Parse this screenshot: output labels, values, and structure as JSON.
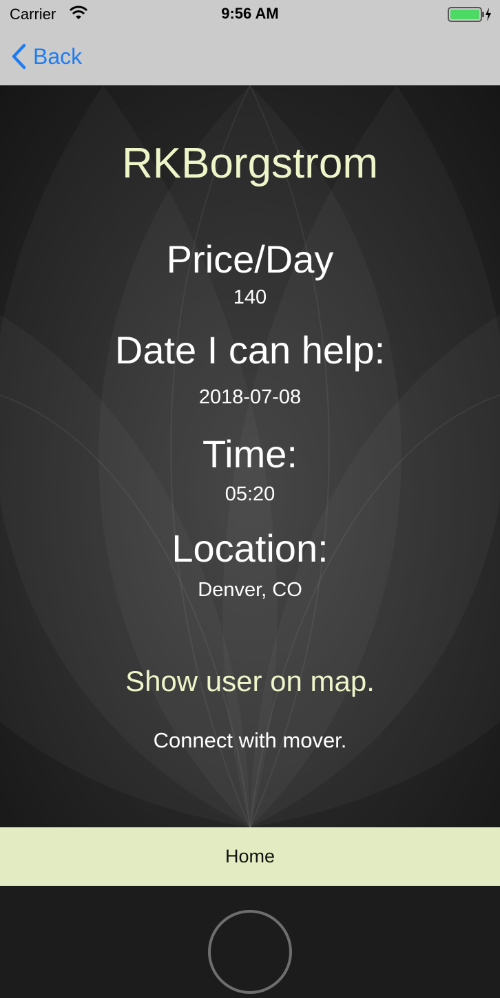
{
  "status_bar": {
    "carrier": "Carrier",
    "time": "9:56 AM"
  },
  "nav": {
    "back_label": "Back"
  },
  "profile": {
    "username": "RKBorgstrom",
    "price_label": "Price/Day",
    "price_value": "140",
    "date_label": "Date I can help:",
    "date_value": "2018-07-08",
    "time_label": "Time:",
    "time_value": "05:20",
    "location_label": "Location:",
    "location_value": "Denver, CO"
  },
  "actions": {
    "show_map": "Show user on map.",
    "connect": "Connect with mover."
  },
  "toolbar": {
    "home_label": "Home"
  },
  "colors": {
    "accent_text": "#eef5c9",
    "back_blue": "#1e7cf2",
    "home_bar": "#e2ebc2",
    "battery_green": "#4cd964"
  }
}
